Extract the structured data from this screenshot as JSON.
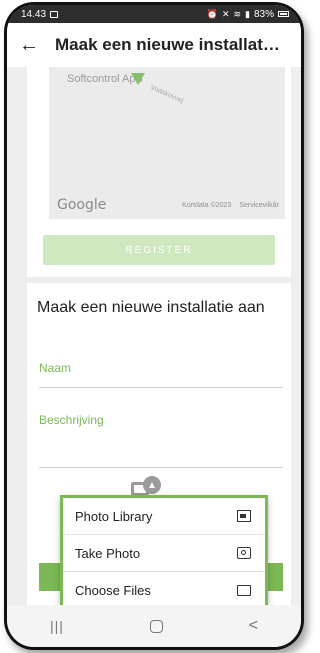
{
  "statusbar": {
    "time": "14.43",
    "battery": "83%"
  },
  "appbar": {
    "title": "Maak een nieuwe installati…"
  },
  "map": {
    "place": "Softcontrol ApS",
    "road": "Vodskovvej",
    "google": "Google",
    "keyboard_shortcuts": "Kortdata ©2023",
    "terms": "Servicevilkår"
  },
  "register_label": "REGISTER",
  "form": {
    "title": "Maak een nieuwe installatie aan",
    "name_label": "Naam",
    "description_label": "Beschrijving"
  },
  "menu": {
    "items": [
      {
        "label": "Photo Library",
        "icon": "photo-library-icon"
      },
      {
        "label": "Take Photo",
        "icon": "camera-icon"
      },
      {
        "label": "Choose Files",
        "icon": "folder-icon"
      }
    ]
  },
  "colors": {
    "accent": "#7cb856",
    "register_disabled": "#cfe8bf"
  }
}
